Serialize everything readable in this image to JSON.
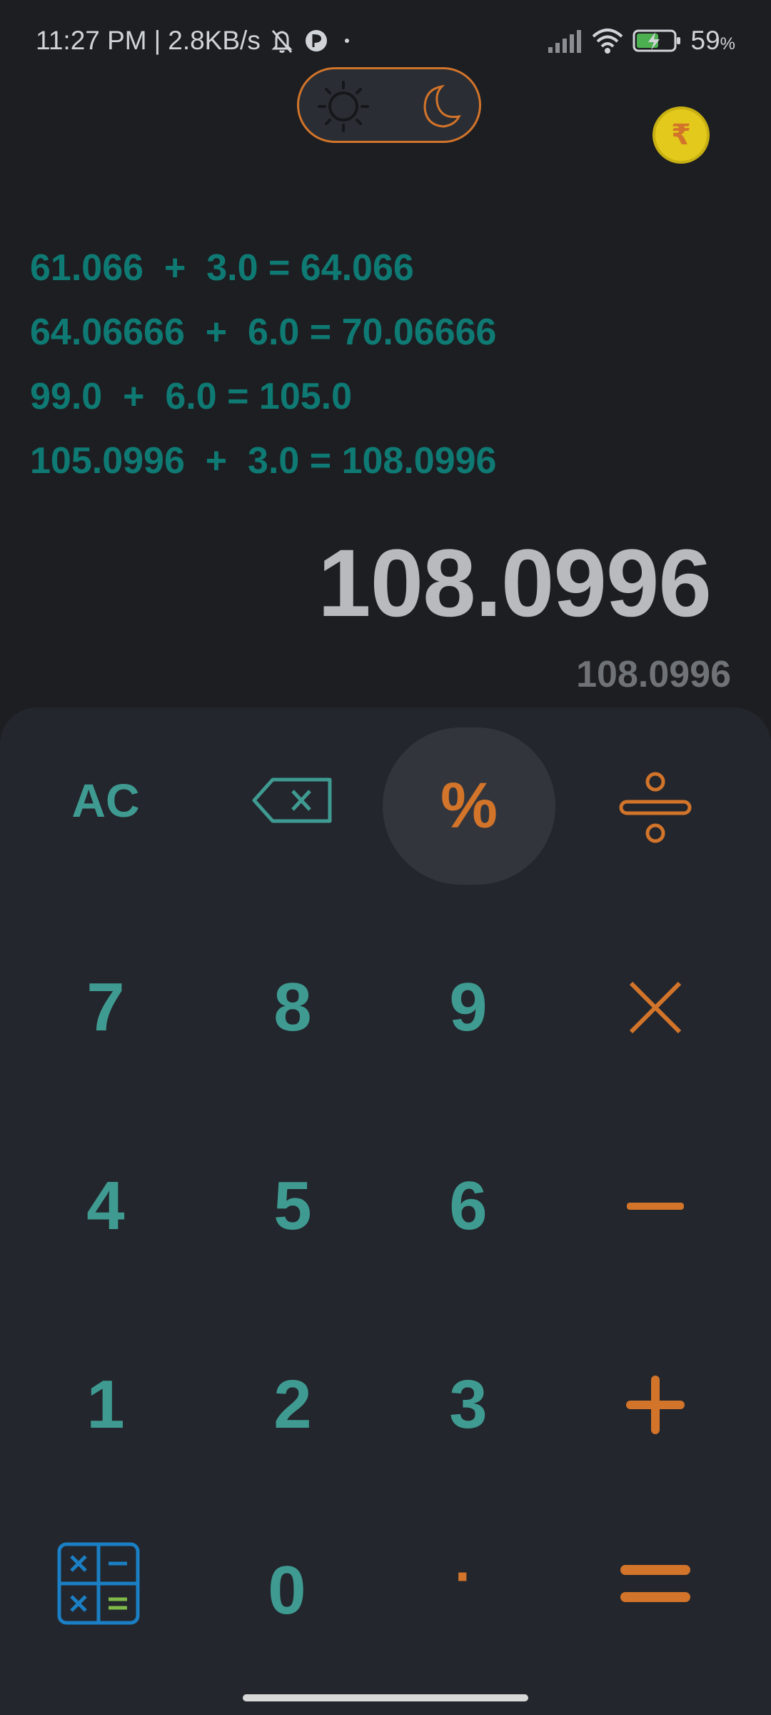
{
  "status_bar": {
    "time": "11:27 PM",
    "separator": "|",
    "net_speed": "2.8KB/s",
    "battery_percent": "59",
    "battery_unit": "%",
    "icons": [
      "mute-bell-icon",
      "app-notification-icon",
      "dot-icon",
      "signal-icon",
      "wifi-icon",
      "battery-charging-icon"
    ]
  },
  "theme_toggle": {
    "options": [
      "sun-icon",
      "moon-icon"
    ],
    "accent": "#d2742a"
  },
  "coin_badge": {
    "symbol": "₹"
  },
  "history": [
    "61.066  +  3.0 = 64.066",
    "64.06666  +  6.0 = 70.06666",
    "99.0  +  6.0 = 105.0",
    "105.0996  +  3.0 = 108.0996"
  ],
  "display": {
    "result": "108.0996",
    "preview": "108.0996"
  },
  "keys": {
    "clear": "AC",
    "backspace_icon": "backspace-icon",
    "percent": "%",
    "divide_icon": "divide-icon",
    "seven": "7",
    "eight": "8",
    "nine": "9",
    "multiply_icon": "multiply-icon",
    "four": "4",
    "five": "5",
    "six": "6",
    "minus_icon": "minus-icon",
    "one": "1",
    "two": "2",
    "three": "3",
    "plus_icon": "plus-icon",
    "mode_icon": "calculator-mode-icon",
    "zero": "0",
    "decimal": "·",
    "equals_icon": "equals-icon"
  },
  "colors": {
    "background": "#1c1e22",
    "keypad": "#23262c",
    "number": "#3f9b92",
    "history": "#0f7a73",
    "operator": "#d2742a",
    "result": "#b8babd"
  }
}
